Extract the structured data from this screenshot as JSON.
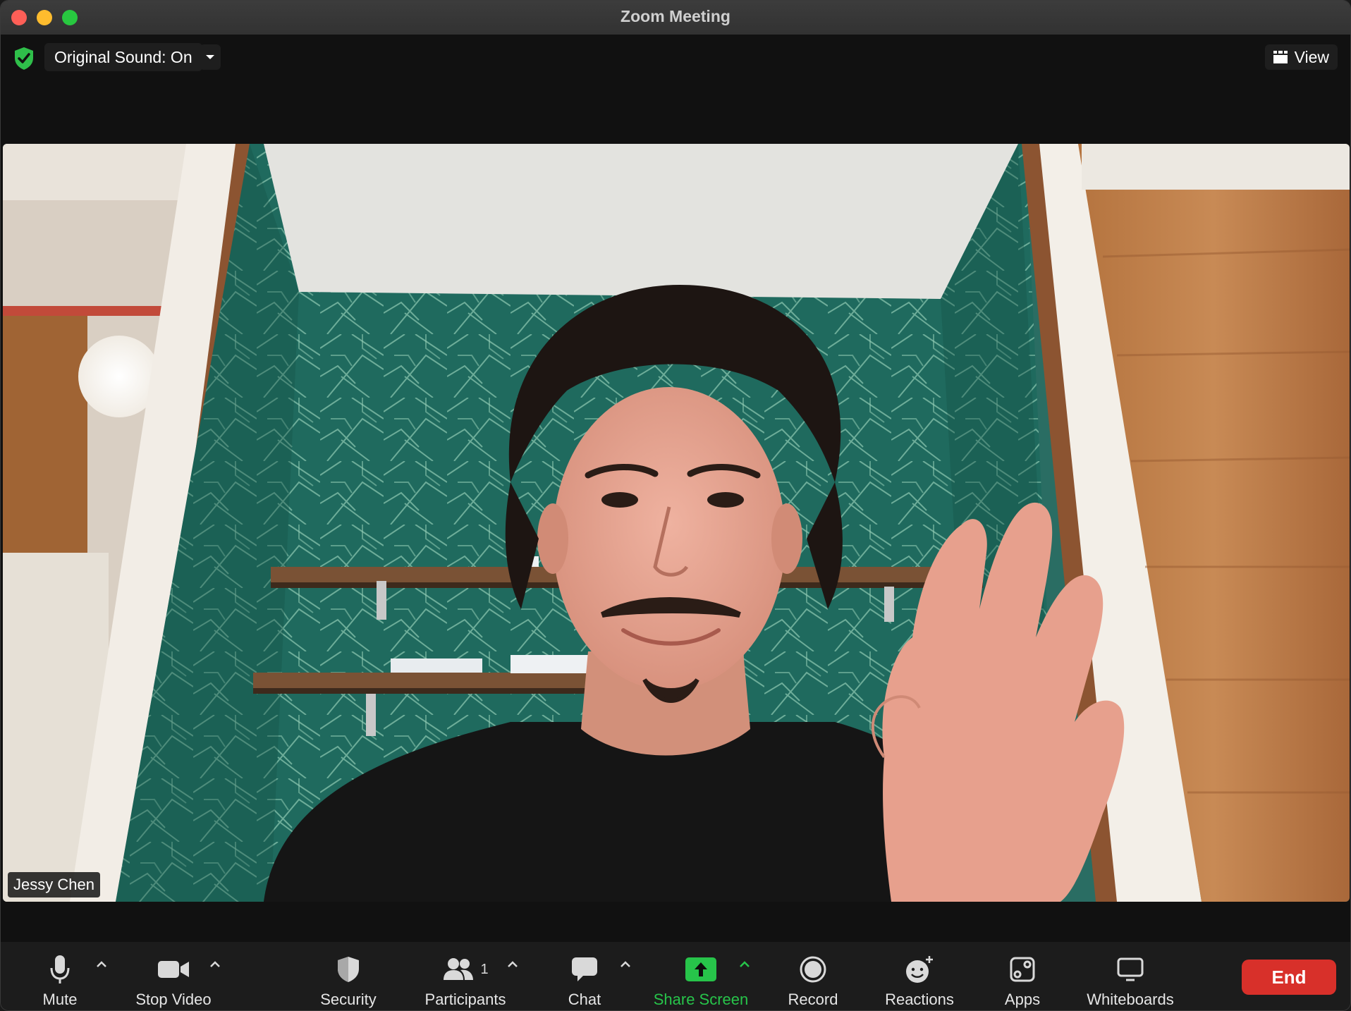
{
  "window": {
    "title": "Zoom Meeting"
  },
  "topbar": {
    "original_sound_label": "Original Sound: On",
    "view_label": "View"
  },
  "video": {
    "participant_name": "Jessy Chen"
  },
  "toolbar": {
    "mute_label": "Mute",
    "stop_video_label": "Stop Video",
    "security_label": "Security",
    "participants_label": "Participants",
    "participants_count": "1",
    "chat_label": "Chat",
    "share_screen_label": "Share Screen",
    "record_label": "Record",
    "reactions_label": "Reactions",
    "apps_label": "Apps",
    "whiteboards_label": "Whiteboards",
    "end_label": "End"
  },
  "colors": {
    "share_green": "#27c44a",
    "end_red": "#d8302a",
    "secure_green": "#2fbf4a"
  }
}
